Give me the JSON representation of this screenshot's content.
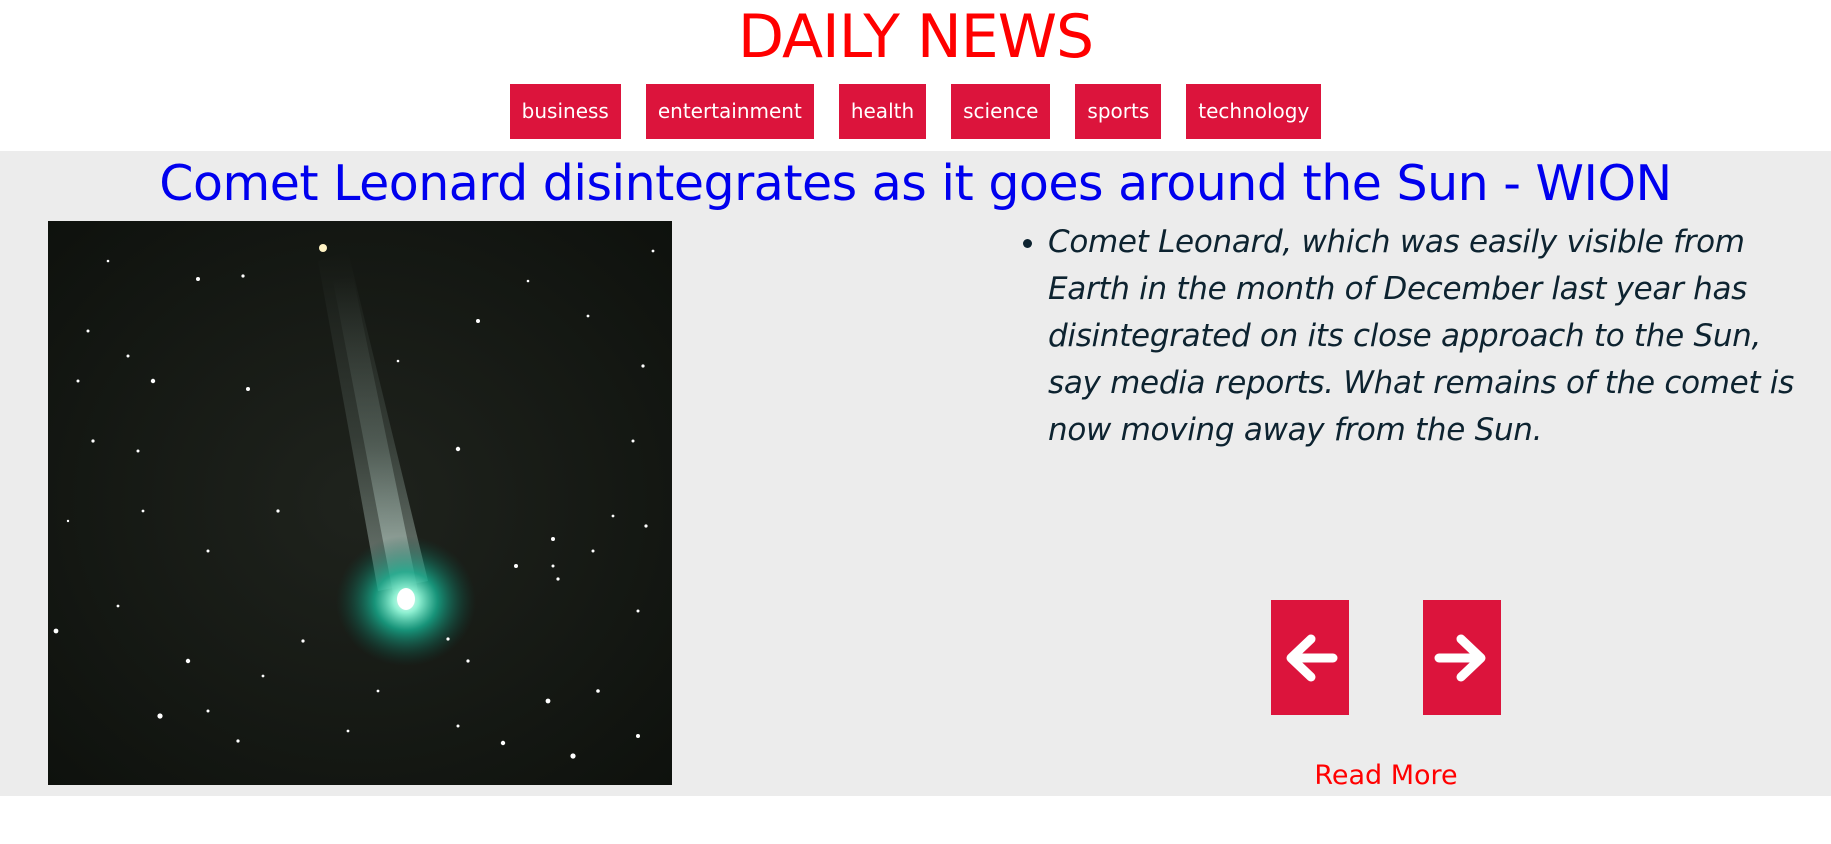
{
  "site": {
    "title": "DAILY NEWS"
  },
  "nav": {
    "categories": [
      "business",
      "entertainment",
      "health",
      "science",
      "sports",
      "technology"
    ]
  },
  "article": {
    "headline": "Comet Leonard disintegrates as it goes around the Sun - WION",
    "summary": "Comet Leonard, which was easily visible from Earth in the month of December last year has disintegrated on its close approach to the Sun, say media reports. What remains of the comet is now moving away from the Sun.",
    "read_more_label": "Read More"
  },
  "controls": {
    "prev_icon": "arrow-left-icon",
    "next_icon": "arrow-right-icon"
  },
  "colors": {
    "brand_red": "#ff0000",
    "button_crimson": "#dc143c",
    "headline_blue": "#0000ee",
    "card_background": "#ececec",
    "summary_text": "#0d2330"
  }
}
